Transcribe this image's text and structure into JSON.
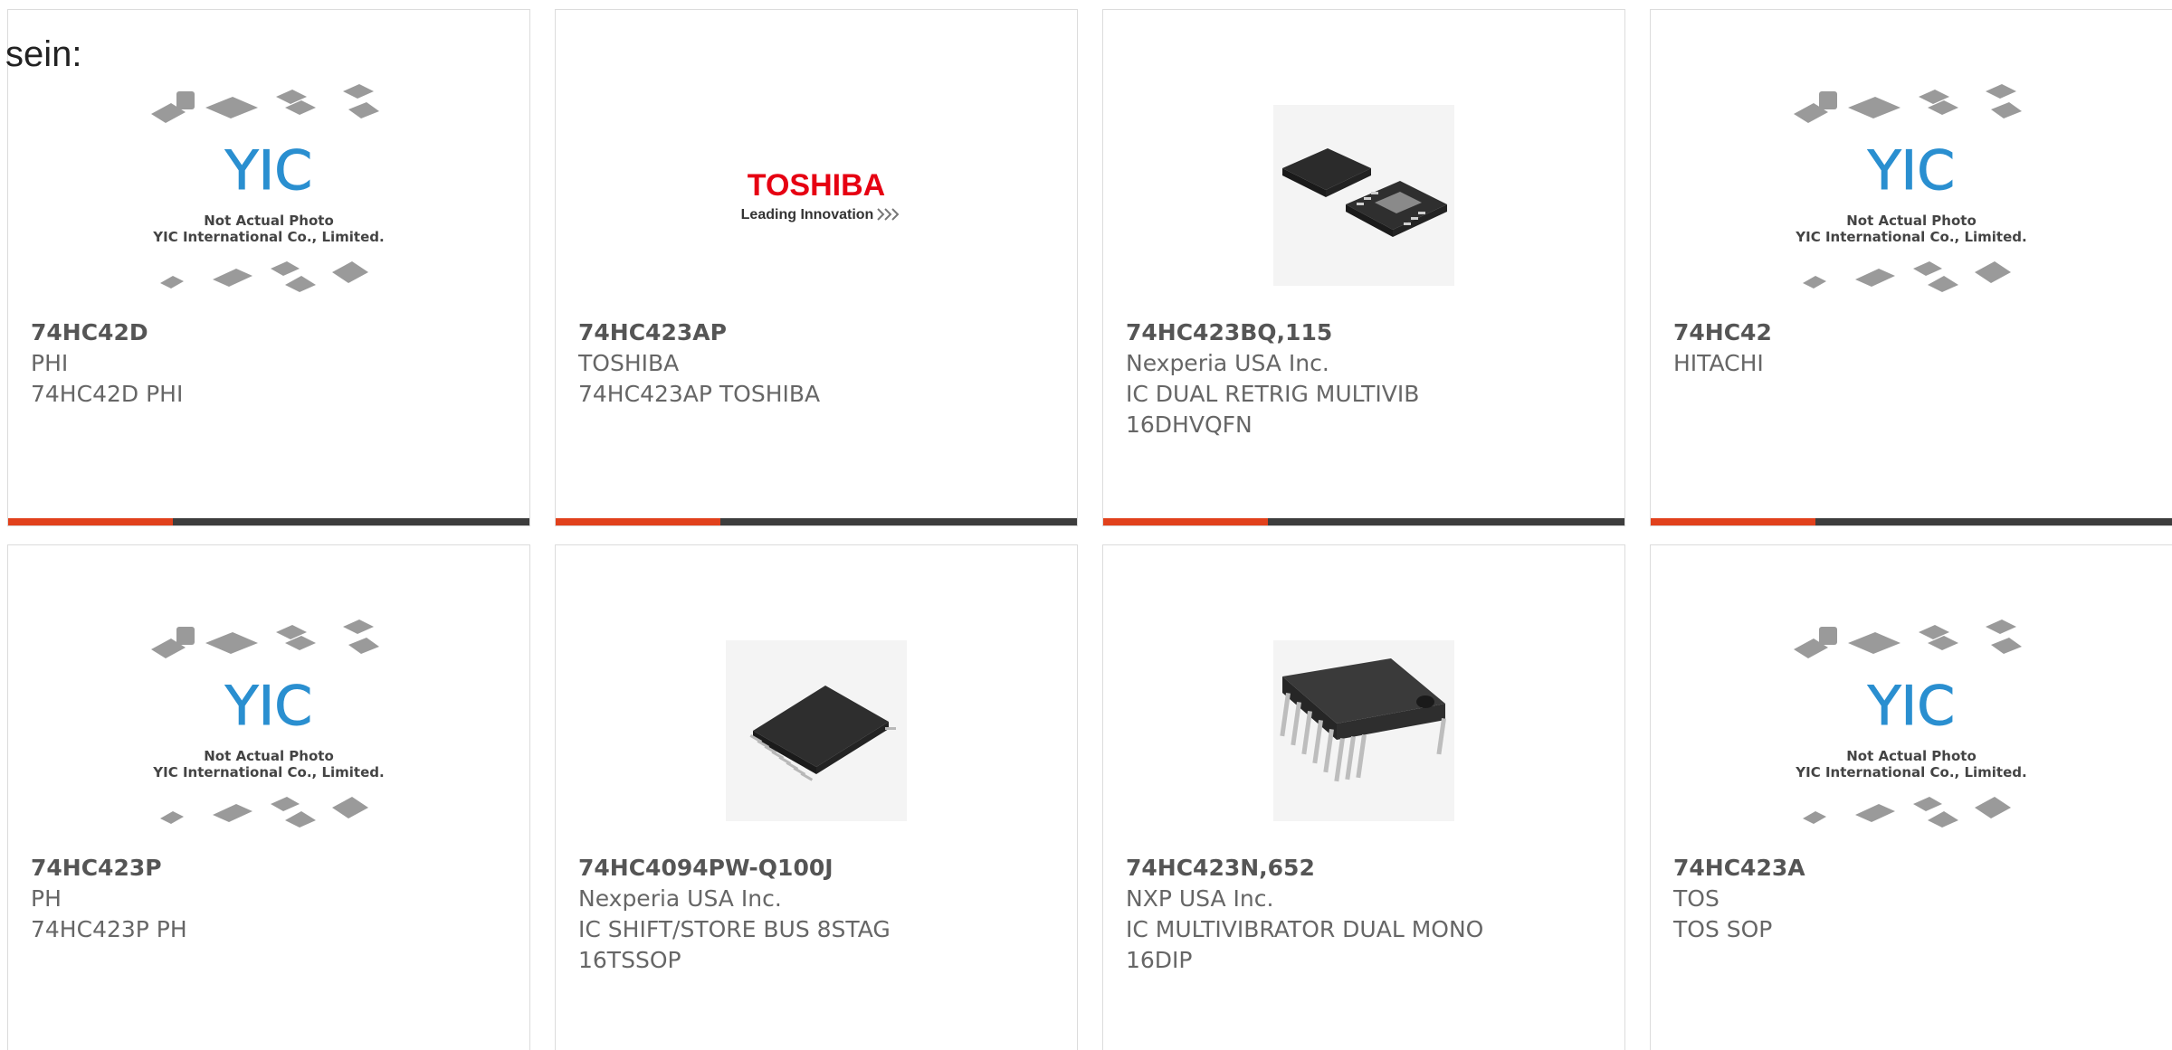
{
  "prefix_text": "sein:",
  "colors": {
    "accent": "#e1411c",
    "bar": "#3d3d3d",
    "yic_blue": "#2a8fd0",
    "toshiba_red": "#e60012"
  },
  "placeholder": {
    "line1": "Not Actual Photo",
    "line2": "YIC International Co., Limited."
  },
  "toshiba_logo": {
    "brand": "TOSHIBA",
    "tagline": "Leading Innovation"
  },
  "products": [
    {
      "part": "74HC42D",
      "maker": "PHI",
      "desc1": "74HC42D PHI",
      "desc2": "",
      "image": "yic-placeholder"
    },
    {
      "part": "74HC423AP",
      "maker": "TOSHIBA",
      "desc1": "74HC423AP TOSHIBA",
      "desc2": "",
      "image": "toshiba-logo"
    },
    {
      "part": "74HC423BQ,115",
      "maker": "Nexperia USA Inc.",
      "desc1": "IC DUAL RETRIG MULTIVIB",
      "desc2": "16DHVQFN",
      "image": "qfn-chip"
    },
    {
      "part": "74HC42",
      "maker": "HITACHI",
      "desc1": "",
      "desc2": "",
      "image": "yic-placeholder"
    },
    {
      "part": "74HC423P",
      "maker": "PH",
      "desc1": "74HC423P PH",
      "desc2": "",
      "image": "yic-placeholder"
    },
    {
      "part": "74HC4094PW-Q100J",
      "maker": "Nexperia USA Inc.",
      "desc1": "IC SHIFT/STORE BUS 8STAG",
      "desc2": "16TSSOP",
      "image": "tssop-chip"
    },
    {
      "part": "74HC423N,652",
      "maker": "NXP USA Inc.",
      "desc1": "IC MULTIVIBRATOR DUAL MONO",
      "desc2": "16DIP",
      "image": "dip-chip"
    },
    {
      "part": "74HC423A",
      "maker": "TOS",
      "desc1": "TOS SOP",
      "desc2": "",
      "image": "yic-placeholder"
    }
  ]
}
